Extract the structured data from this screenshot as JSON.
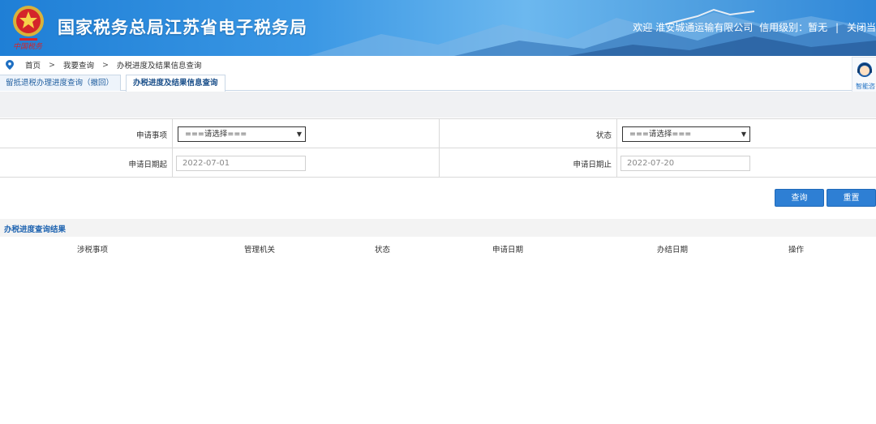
{
  "header": {
    "site_title": "国家税务总局江苏省电子税务局",
    "welcome": "欢迎",
    "company": "淮安城通运输有限公司",
    "credit_label": "信用级别：暂无",
    "separator": "|",
    "close_link": "关闭当"
  },
  "breadcrumb": {
    "items": [
      "首页",
      "我要查询",
      "办税进度及结果信息查询"
    ],
    "separator": ">"
  },
  "tabs": [
    {
      "label": "留抵退税办理进度查询（撤回）",
      "active": false
    },
    {
      "label": "办税进度及结果信息查询",
      "active": true
    }
  ],
  "assistant": {
    "label": "智能咨"
  },
  "form": {
    "item_label": "申请事项",
    "item_select": "===请选择===",
    "status_label": "状态",
    "status_select": "===请选择===",
    "start_label": "申请日期起",
    "start_value": "2022-07-01",
    "end_label": "申请日期止",
    "end_value": "2022-07-20"
  },
  "buttons": {
    "query": "查询",
    "reset": "重置"
  },
  "results": {
    "title": "办税进度查询结果",
    "columns": [
      "涉税事项",
      "管理机关",
      "状态",
      "申请日期",
      "办结日期",
      "操作"
    ]
  }
}
